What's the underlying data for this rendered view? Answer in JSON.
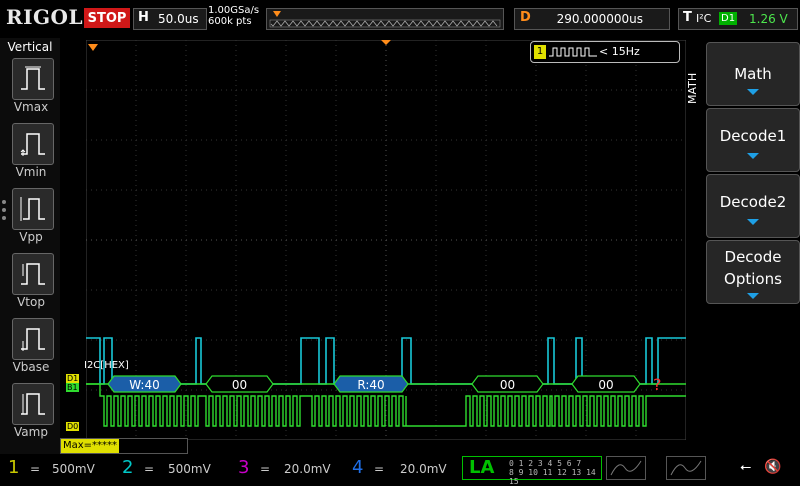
{
  "top": {
    "logo": "RIGOL",
    "run_state": "STOP",
    "horizontal": {
      "key": "H",
      "value": "50.0us"
    },
    "sample_rate": "1.00GSa/s",
    "memory_depth": "600k pts",
    "delay": {
      "key": "D",
      "value": "290.000000us"
    },
    "trigger": {
      "key": "T",
      "type": "I²C",
      "source": "D1",
      "level": "1.26 V"
    }
  },
  "left_panel": {
    "title": "Vertical",
    "items": [
      {
        "label": "Vmax"
      },
      {
        "label": "Vmin"
      },
      {
        "label": "Vpp"
      },
      {
        "label": "Vtop"
      },
      {
        "label": "Vbase"
      },
      {
        "label": "Vamp"
      }
    ]
  },
  "screen": {
    "freq_counter": "< 15Hz",
    "freq_channel": "1",
    "bus_label": "I2C[HEX]",
    "d1_tag": "D1",
    "b1_tag": "B1",
    "d0_tag": "D0",
    "measure_readout": "Max=*****",
    "decode_packets": [
      {
        "text": "W:40",
        "color": "#1b5ea8"
      },
      {
        "text": "00",
        "color": "#000000"
      },
      {
        "text": "R:40",
        "color": "#1b5ea8"
      },
      {
        "text": "00",
        "color": "#000000"
      },
      {
        "text": "00",
        "color": "#000000"
      }
    ],
    "decode_error": "?"
  },
  "right_menu": {
    "tab": "MATH",
    "buttons": [
      {
        "label": "Math"
      },
      {
        "label": "Decode1"
      },
      {
        "label": "Decode2"
      },
      {
        "label_line1": "Decode",
        "label_line2": "Options"
      }
    ]
  },
  "bottom": {
    "channels": [
      {
        "num": "1",
        "value": "500mV",
        "color": "#c8c800"
      },
      {
        "num": "2",
        "value": "500mV",
        "color": "#00c8c8"
      },
      {
        "num": "3",
        "value": "20.0mV",
        "color": "#c800c8"
      },
      {
        "num": "4",
        "value": "20.0mV",
        "color": "#1e6ee6"
      }
    ],
    "la": {
      "label": "LA",
      "row1": "0 1 2 3   4 5 6 7",
      "row2": "8 9 10 11  12 13 14 15"
    },
    "colors": {
      "accent_blue": "#1ea0e6",
      "digital_green": "#00e000",
      "trace_cyan": "#18c8d8",
      "trace_green": "#2fdc2f"
    }
  }
}
